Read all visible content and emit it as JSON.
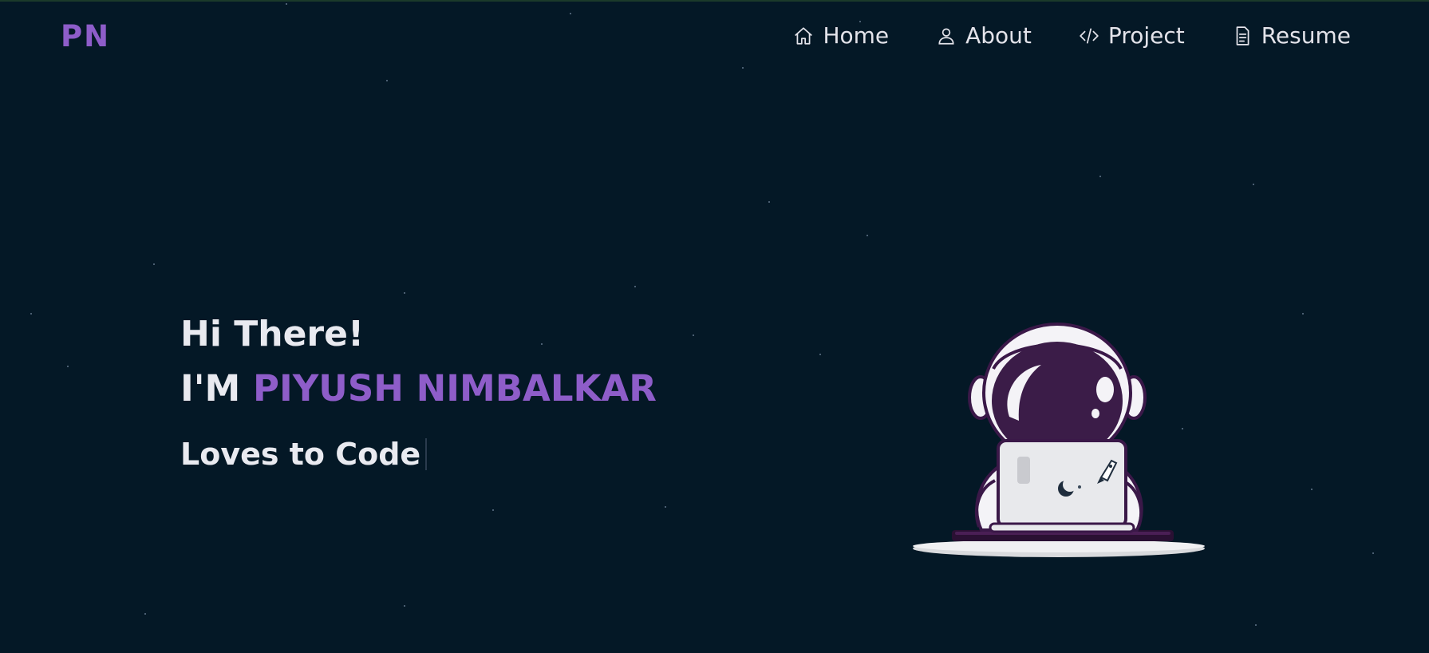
{
  "logo": "PN",
  "nav": {
    "items": [
      {
        "label": "Home",
        "icon": "home-icon"
      },
      {
        "label": "About",
        "icon": "user-icon"
      },
      {
        "label": "Project",
        "icon": "code-icon"
      },
      {
        "label": "Resume",
        "icon": "document-icon"
      }
    ]
  },
  "hero": {
    "greeting": "Hi There!",
    "intro_prefix": "I'M",
    "name": "PIYUSH NIMBALKAR",
    "tagline": "Loves to Code"
  },
  "illustration": {
    "icon": "astronaut-laptop-illustration"
  },
  "colors": {
    "background": "#041826",
    "accent": "#8e5dc9",
    "text": "#e9eaf0"
  }
}
